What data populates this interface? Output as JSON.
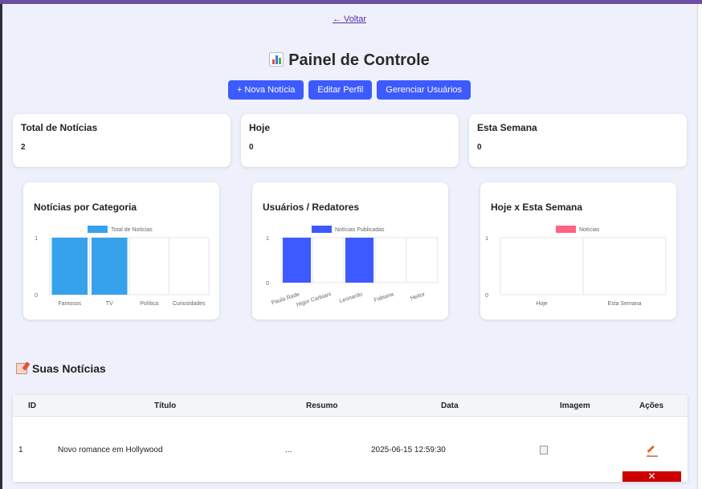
{
  "nav": {
    "back_label": "← Voltar"
  },
  "page": {
    "title": "Painel de Controle",
    "title_icon": "bar-chart-emoji-icon"
  },
  "actions": {
    "new_news": "+ Nova Notícia",
    "edit_profile": "Editar Perfil",
    "manage_users": "Gerenciar Usuários"
  },
  "colors": {
    "accent": "#3d5afe",
    "category_bar": "#36a2eb",
    "users_bar": "#3d5afe",
    "period_legend": "#ff6384",
    "delete": "#cc0000"
  },
  "stats": [
    {
      "label": "Total de Notícias",
      "value": "2"
    },
    {
      "label": "Hoje",
      "value": "0"
    },
    {
      "label": "Esta Semana",
      "value": "0"
    }
  ],
  "chart_data": [
    {
      "type": "bar",
      "title": "Notícias por Categoria",
      "categories": [
        "Famosos",
        "TV",
        "Política",
        "Curiosidades"
      ],
      "series": [
        {
          "name": "Total de Notícias",
          "values": [
            1,
            1,
            0,
            0
          ]
        }
      ],
      "yticks": [
        "0",
        "1"
      ],
      "ylim": [
        0,
        1
      ],
      "legend": "top",
      "grid": true
    },
    {
      "type": "bar",
      "title": "Usuários / Redatores",
      "categories": [
        "Paula Rade",
        "Higor Carbiani",
        "Leonardo",
        "Fabiana",
        "Heitor"
      ],
      "series": [
        {
          "name": "Notícias Publicadas",
          "values": [
            1,
            0,
            1,
            0,
            0
          ]
        }
      ],
      "yticks": [
        "0",
        "1"
      ],
      "ylim": [
        0,
        1
      ],
      "legend": "top",
      "grid": true
    },
    {
      "type": "bar",
      "title": "Hoje x Esta Semana",
      "categories": [
        "Hoje",
        "Esta Semana"
      ],
      "series": [
        {
          "name": "Notícias",
          "values": [
            0,
            0
          ]
        }
      ],
      "yticks": [
        "0",
        "1"
      ],
      "ylim": [
        0,
        1
      ],
      "legend": "top",
      "grid": true
    }
  ],
  "news_section": {
    "title": "Suas Notícias",
    "columns": [
      "ID",
      "Título",
      "Resumo",
      "Data",
      "Imagem",
      "Ações"
    ],
    "rows": [
      {
        "id": "1",
        "title": "Novo romance em Hollywood",
        "summary": "...",
        "date": "2025-06-15 12:59:30",
        "image": "broken-image-icon"
      }
    ],
    "delete_symbol": "✕"
  }
}
